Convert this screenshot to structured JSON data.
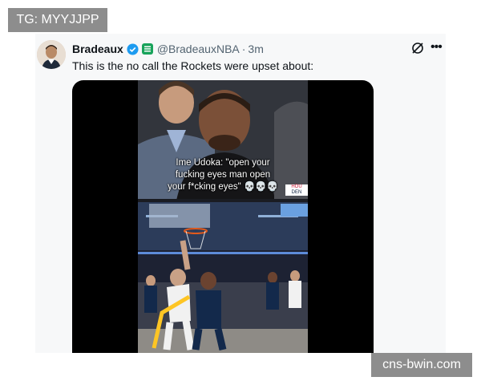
{
  "watermark_top": "TG: MYYJJPP",
  "watermark_bottom": "cns-bwin.com",
  "tweet": {
    "display_name": "Bradeaux",
    "handle": "@BradeauxNBA",
    "separator": "·",
    "time": "3m",
    "text": "This is the no call the Rockets were upset about:",
    "icons": {
      "verified": "verified-badge-icon",
      "affiliate": "affiliate-badge-icon",
      "grok": "grok-icon",
      "more": "more-options-icon"
    },
    "video": {
      "caption_line1": "Ime Udoka: \"open your",
      "caption_line2": "fucking eyes man open",
      "caption_line3": "your f*cking eyes\" 💀💀💀",
      "score_home": "HOU",
      "score_away": "DEN"
    }
  },
  "colors": {
    "accent": "#1d9bf0",
    "watermark_bg": "#8d8d8d",
    "tweet_bg": "#f7f8f9"
  }
}
